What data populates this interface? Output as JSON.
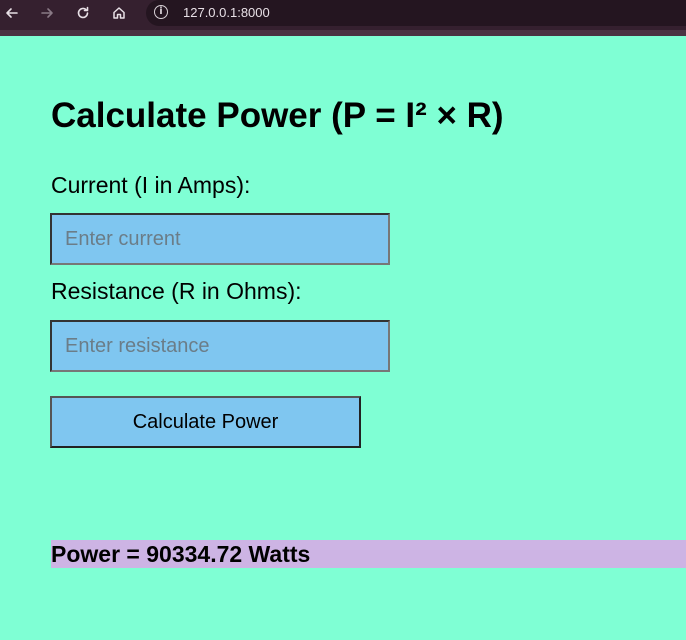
{
  "browser": {
    "url": "127.0.0.1:8000"
  },
  "icons": {
    "back": "arrow-left-icon",
    "forward": "arrow-right-icon",
    "reload": "reload-icon",
    "home": "home-icon",
    "site_info": "info-icon"
  },
  "form": {
    "title": "Calculate Power (P = I² × R)",
    "current_label": "Current (I in Amps):",
    "current_placeholder": "Enter current",
    "current_value": "",
    "resistance_label": "Resistance (R in Ohms):",
    "resistance_placeholder": "Enter resistance",
    "resistance_value": "",
    "button_label": "Calculate Power"
  },
  "result": {
    "text": "Power = 90334.72 Watts"
  },
  "colors": {
    "page_background": "#7fffd4",
    "input_background": "#7fc6f0",
    "result_background": "#cdb4e4",
    "browser_bar": "#35202f"
  }
}
